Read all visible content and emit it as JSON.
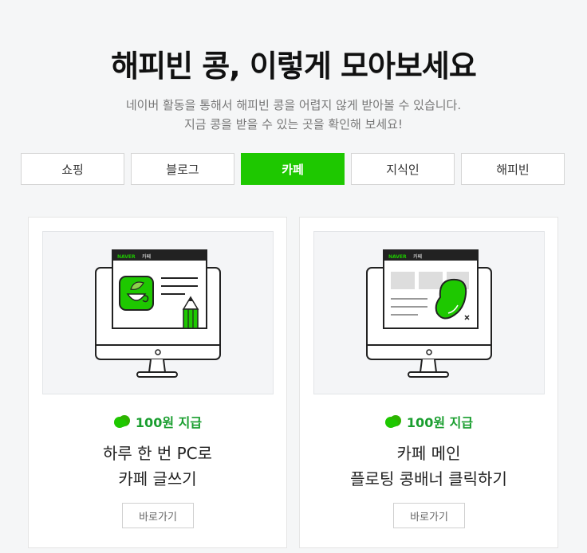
{
  "page": {
    "title": "해피빈 콩, 이렇게 모아보세요",
    "desc_line1": "네이버 활동을 통해서 해피빈 콩을 어렵지 않게 받아볼 수 있습니다.",
    "desc_line2": "지금 콩을 받을 수 있는 곳을 확인해 보세요!"
  },
  "tabs": [
    {
      "label": "쇼핑",
      "active": false
    },
    {
      "label": "블로그",
      "active": false
    },
    {
      "label": "카페",
      "active": true
    },
    {
      "label": "지식인",
      "active": false
    },
    {
      "label": "해피빈",
      "active": false
    }
  ],
  "cards": [
    {
      "reward": "100원 지급",
      "title_line1": "하루 한 번 PC로",
      "title_line2": "카페 글쓰기",
      "button": "바로가기",
      "window_brand": "NAVER",
      "window_service": "카페"
    },
    {
      "reward": "100원 지급",
      "title_line1": "카페 메인",
      "title_line2": "플로팅 콩배너 클릭하기",
      "button": "바로가기",
      "window_brand": "NAVER",
      "window_service": "카페"
    }
  ],
  "colors": {
    "accent": "#1ec800",
    "reward_text": "#1a9e2f",
    "bean": "#2db400"
  }
}
